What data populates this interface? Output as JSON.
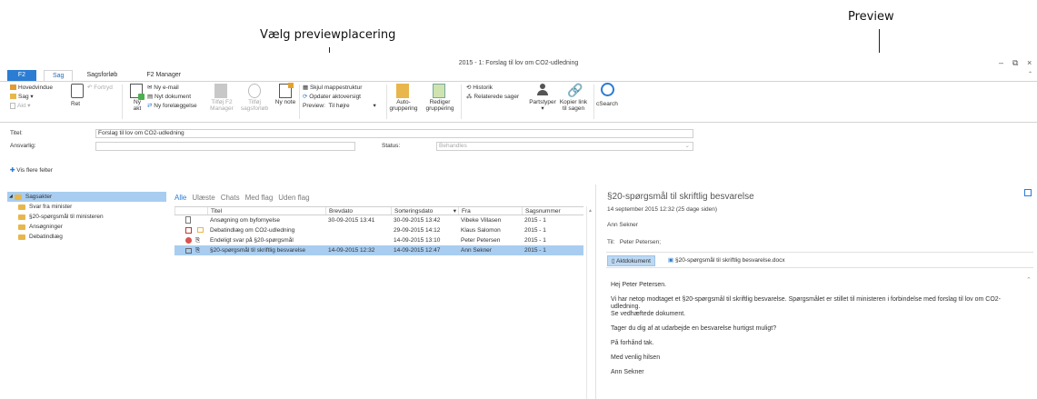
{
  "annotations": {
    "preview": "Preview",
    "placement": "Vælg previewplacering"
  },
  "window": {
    "title": "2015 - 1: Forslag til lov om CO2-udledning",
    "controls": {
      "minimize": "–",
      "restore": "⧉",
      "close": "×",
      "collapse": "⌃"
    }
  },
  "tabs": [
    "F2",
    "Sag",
    "Sagsforløb",
    "F2 Manager"
  ],
  "ribbon": {
    "hovedvindue": "Hovedvindue",
    "sag": "Sag",
    "akt": "Akt",
    "fortryd": "Fortryd",
    "ret": "Ret",
    "ny_akt": "Ny akt",
    "ny_email": "Ny e-mail",
    "nyt_dokument": "Nyt dokument",
    "ny_forelaeggelse": "Ny forelæggelse",
    "tilfoj_f2_manager": "Tilføj F2 Manager",
    "tilfoj_sagsforlob": "Tilføj sagsforløb",
    "ny_note": "Ny note",
    "skjul_mappestruktur": "Skjul mappestruktur",
    "opdater_aktoversigt": "Opdater aktoversigt",
    "preview_label": "Preview:",
    "preview_value": "Til højre",
    "autogruppering": "Auto-gruppering",
    "rediger_gruppering": "Rediger gruppering",
    "historik": "Historik",
    "relaterede_sager": "Relaterede sager",
    "partstyper": "Partstyper",
    "kopier_link": "Kopier link til sagen",
    "csearch": "cSearch"
  },
  "fields": {
    "titel_label": "Titel:",
    "titel_value": "Forslag til lov om CO2-udledning",
    "ansvarlig_label": "Ansvarlig:",
    "status_label": "Status:",
    "status_value": "Behandles",
    "vis_flere": "Vis flere felter"
  },
  "tree": {
    "root": "Sagsakter",
    "items": [
      "Svar fra minister",
      "§20-spørgsmål til ministeren",
      "Ansøgninger",
      "Debatindlæg"
    ]
  },
  "filters": [
    "Alle",
    "Ulæste",
    "Chats",
    "Med flag",
    "Uden flag"
  ],
  "grid": {
    "headers": [
      "",
      "Titel",
      "Brevdato",
      "Sorteringsdato",
      "Fra",
      "Sagsnummer"
    ],
    "rows": [
      {
        "title": "Ansøgning om byfornyelse",
        "brevdato": "30-09-2015 13:41",
        "sortering": "30-09-2015 13:42",
        "fra": "Vibeke Villasen",
        "sagsnr": "2015 - 1"
      },
      {
        "title": "Debatindlæg om CO2-udledning",
        "brevdato": "",
        "sortering": "29-09-2015 14:12",
        "fra": "Klaus Salomon",
        "sagsnr": "2015 - 1"
      },
      {
        "title": "Endeligt svar på §20-spørgsmål",
        "brevdato": "",
        "sortering": "14-09-2015 13:10",
        "fra": "Peter Petersen",
        "sagsnr": "2015 - 1"
      },
      {
        "title": "§20-spørgsmål til skriftlig besvarelse",
        "brevdato": "14-09-2015 12:32",
        "sortering": "14-09-2015 12:47",
        "fra": "Ann Sekner",
        "sagsnr": "2015 - 1"
      }
    ]
  },
  "preview": {
    "subject": "§20-spørgsmål til skriftlig besvarelse",
    "date": "14 september 2015 12:32 (25 dage siden)",
    "from": "Ann Sekner",
    "to_label": "Til:",
    "to_value": "Peter Petersen;",
    "att_tab1": "Aktdokument",
    "att_tab2": "§20-spørgsmål til skriftlig besvarelse.docx",
    "body": [
      "Hej Peter Petersen.",
      "Vi har netop modtaget et §20-spørgsmål til skriftlig besvarelse. Spørgsmålet er stillet til ministeren i forbindelse med forslag til lov om CO2-udledning.\nSe vedhæftede dokument.",
      "Tager du dig af at udarbejde en besvarelse hurtigst muligt?",
      "På forhånd tak.",
      "Med venlig hilsen",
      "Ann Sekner"
    ]
  }
}
